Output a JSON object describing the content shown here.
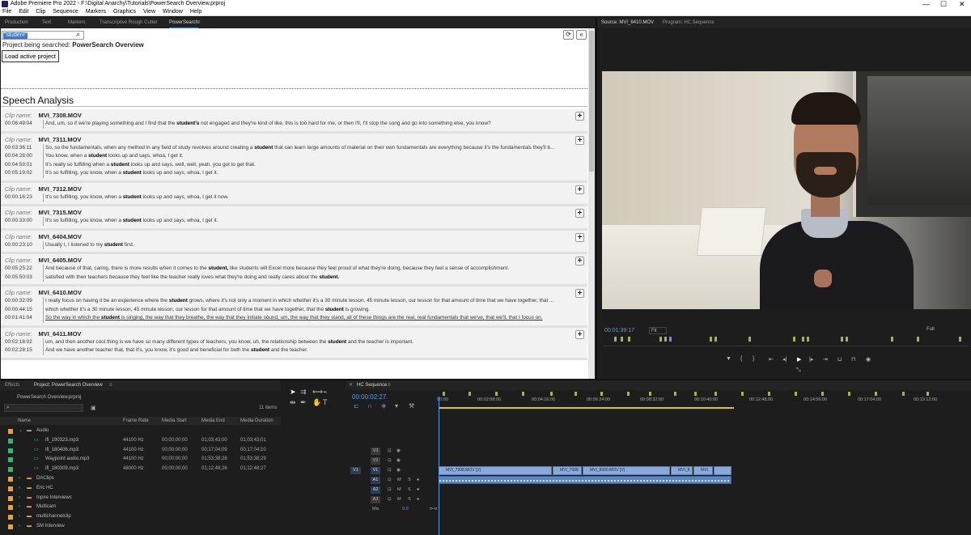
{
  "window": {
    "title": "Adobe Premiere Pro 2022 - F:\\Digital Anarchy\\Tutorials\\PowerSearch Overview.prproj"
  },
  "menu": [
    "File",
    "Edit",
    "Clip",
    "Sequence",
    "Markers",
    "Graphics",
    "View",
    "Window",
    "Help"
  ],
  "workspace_tabs": [
    "Production",
    "Text",
    "Markers",
    "Transcriptive Rough Cutter",
    "PowerSearch"
  ],
  "powersearch": {
    "query": "\"student\"",
    "project_label": "Project being searched: ",
    "project_name": "PowerSearch Overview",
    "load_button": "Load active project",
    "section_title": "Speech Analysis",
    "clip_label": "Clip name:",
    "clips": [
      {
        "name": "MVI_7308.MOV",
        "rows": [
          {
            "tc": "00:06:49:04",
            "text": "And, um, so if we're playing something and I find that the |student's| not engaged and they're kind of like, this is too hard for me, or then I'll, I'll stop the song and go into something else, you know?"
          }
        ]
      },
      {
        "name": "MVI_7311.MOV",
        "rows": [
          {
            "tc": "00:03:36:11",
            "text": "So, so the fundamentals, when any method in any field of study revolves around creating a |student| that can learn large amounts of material on their own fundamentals are everything because it's the fundamentals they'll b..."
          },
          {
            "tc": "00:04:28:00",
            "text": "You know, when a |student| looks up and says, whoa, I get it."
          },
          {
            "tc": "00:04:59:01",
            "text": "It's really so fulfilling when a |student| looks up and says, well, well, yeah, you got to get that."
          },
          {
            "tc": "00:05:19:02",
            "text": "It's so fulfilling, you know, when a |student| looks up and says, whoa, I get it."
          }
        ]
      },
      {
        "name": "MVI_7312.MOV",
        "rows": [
          {
            "tc": "00:00:16:23",
            "text": "It's so fulfilling, you know, when a |student| looks up and says, whoa, I get it now."
          }
        ]
      },
      {
        "name": "MVI_7315.MOV",
        "rows": [
          {
            "tc": "00:00:33:00",
            "text": "It's so fulfilling, you know, when a |student| looks up and says, whoa, I get it."
          }
        ]
      },
      {
        "name": "MVI_6404.MOV",
        "rows": [
          {
            "tc": "00:00:23:10",
            "text": "Usually I, I listened to my |student| first."
          }
        ]
      },
      {
        "name": "MVI_6405.MOV",
        "rows": [
          {
            "tc": "00:05:25:22",
            "text": "And because of that, caring, there is more results when it comes to the |student,| like students will Excel more because they feel proud of what they're doing, because they feel a sense of accomplishment."
          },
          {
            "tc": "00:05:50:03",
            "text": "satisfied with their teachers because they feel like the teacher really loves what they're doing and really cares about the |student.|"
          }
        ]
      },
      {
        "name": "MVI_6410.MOV",
        "rows": [
          {
            "tc": "00:00:32:09",
            "text": "I really focus on having it be an experience where the |student| grows, where it's not only a moment in which whether it's a 30 minute lesson, 45 minute lesson, our lesson for that amount of time that we have together, that ..."
          },
          {
            "tc": "00:00:44:15",
            "text": "which whether it's a 30 minute lesson, 45 minute lesson, our lesson for that amount of time that we have together, that the |student| is growing."
          },
          {
            "tc": "00:01:41:04",
            "text": "So the way in which the |student| is singing, the way that they breathe, the way that they initiate sound, um, the way that they stand, all of these things are the real, real fundamentals that we've, that we'll, that I focus on.",
            "underline": true
          }
        ]
      },
      {
        "name": "MVI_6411.MOV",
        "rows": [
          {
            "tc": "00:02:18:02",
            "text": "um, and then another cool thing is we have so many different types of teachers, you know, uh, the relationship between the |student| and the teacher is important."
          },
          {
            "tc": "00:02:28:15",
            "text": "And we have another teacher that, that it's, you know, it's good and beneficial for both the |student| and the teacher."
          }
        ]
      }
    ]
  },
  "source_monitor": {
    "tab_source": "Source: MVI_6410.MOV",
    "tab_program": "Program: HC Sequence",
    "timecode": "00:01:39:17",
    "fit": "Fit",
    "resolution": "Full"
  },
  "project_panel": {
    "tab_effects": "Effects",
    "tab_project": "Project: PowerSearch Overview",
    "file": "PowerSearch Overview.prproj",
    "item_count": "11 items",
    "columns": [
      "Name",
      "Frame Rate",
      "Media Start",
      "Media End",
      "Media Duration"
    ],
    "items": [
      {
        "type": "bin-open",
        "name": "Audio",
        "color": "#e8a33d"
      },
      {
        "type": "file",
        "name": "ifl_190323.mp3",
        "color": "#2fb872",
        "rate": "44100 Hz",
        "start": "00;00;00;00",
        "end": "01;03;43;00",
        "dur": "01;03;43;01"
      },
      {
        "type": "file",
        "name": "ifl_180406.mp3",
        "color": "#2fb872",
        "rate": "44100 Hz",
        "start": "00;00;00;00",
        "end": "00;17;04;09",
        "dur": "00;17;04;10"
      },
      {
        "type": "file",
        "name": "Waypoint audio.mp3",
        "color": "#2fb872",
        "rate": "44100 Hz",
        "start": "00;00;00;00",
        "end": "01;53;38;28",
        "dur": "01;53;38;29"
      },
      {
        "type": "file",
        "name": "ifl_180309.mp3",
        "color": "#2fb872",
        "rate": "48000 Hz",
        "start": "00;00;00;00",
        "end": "01;12;48;26",
        "dur": "01;12;48;27"
      },
      {
        "type": "bin",
        "name": "DAClips",
        "color": "#e8a33d"
      },
      {
        "type": "bin",
        "name": "Eric HC",
        "color": "#e8a33d"
      },
      {
        "type": "bin",
        "name": "Inpire Interviews",
        "color": "#e8a33d"
      },
      {
        "type": "bin",
        "name": "Multicam",
        "color": "#e8a33d"
      },
      {
        "type": "bin",
        "name": "multichannelclip",
        "color": "#e8a33d"
      },
      {
        "type": "bin",
        "name": "SM Interview",
        "color": "#e8a33d"
      }
    ]
  },
  "timeline": {
    "tab": "HC Sequence",
    "timecode": "00:00:02:27",
    "ruler": [
      "00:00",
      "00:02:08:00",
      "00:04:16:00",
      "00:06:24:00",
      "00:08:32:00",
      "00:10:40:00",
      "00:12:48:00",
      "00:14:56:00",
      "00:17:04:00",
      "00:19:12:00"
    ],
    "tracks": [
      "V3",
      "V2",
      "V1",
      "A1",
      "A2",
      "A3"
    ],
    "mix_label": "Mix",
    "mix_value": "0.0",
    "clips": [
      "MVI_7998.MOV [V]",
      "MVI_7998",
      "MVI_8000.MOV [V]",
      "MVI_8",
      "MVI"
    ]
  }
}
